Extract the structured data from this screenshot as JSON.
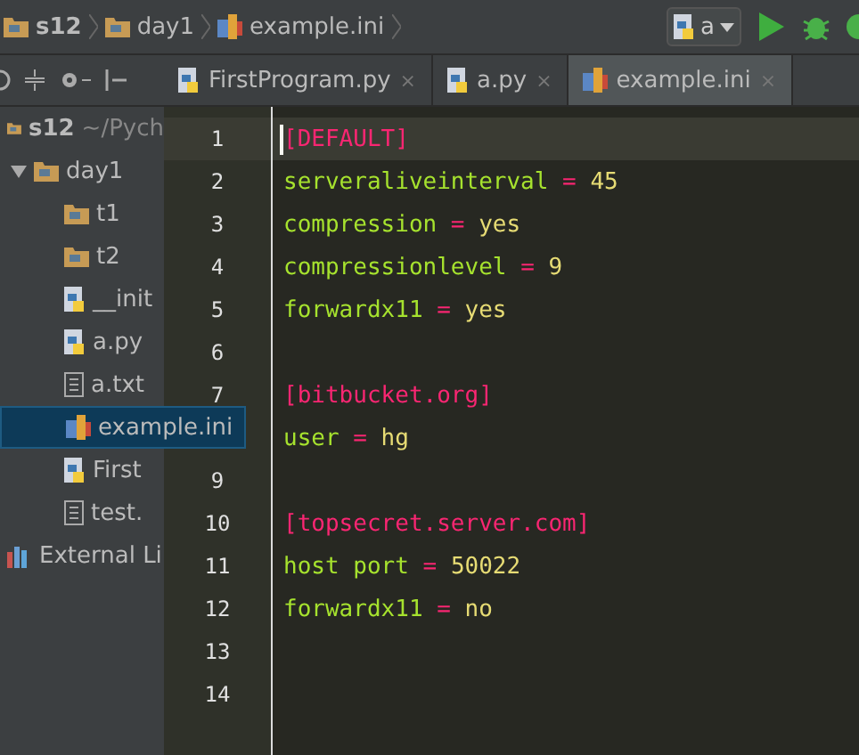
{
  "breadcrumbs": [
    {
      "label": "s12",
      "kind": "folder",
      "bold": true
    },
    {
      "label": "day1",
      "kind": "folder",
      "bold": false
    },
    {
      "label": "example.ini",
      "kind": "ini",
      "bold": false
    }
  ],
  "run_config": {
    "label": "a"
  },
  "tabs": [
    {
      "label": "FirstProgram.py",
      "kind": "python",
      "close": "×",
      "selected": false
    },
    {
      "label": "a.py",
      "kind": "python",
      "close": "×",
      "selected": false
    },
    {
      "label": "example.ini",
      "kind": "ini",
      "close": "×",
      "selected": true
    }
  ],
  "tree": [
    {
      "label": "s12",
      "path": "~/Pych",
      "kind": "folder",
      "selected": false,
      "children": [
        {
          "label": "day1",
          "kind": "folder",
          "expanded": true,
          "selected": false,
          "children": [
            {
              "label": "t1",
              "kind": "folder",
              "selected": false
            },
            {
              "label": "t2",
              "kind": "folder",
              "selected": false
            },
            {
              "label": "__init",
              "kind": "python",
              "selected": false
            },
            {
              "label": "a.py",
              "kind": "python",
              "selected": false
            },
            {
              "label": "a.txt",
              "kind": "text",
              "selected": false
            },
            {
              "label": "example.ini",
              "kind": "ini",
              "selected": true
            },
            {
              "label": "First",
              "kind": "python",
              "selected": false
            },
            {
              "label": "test.",
              "kind": "text",
              "selected": false
            }
          ]
        }
      ]
    },
    {
      "label": "External Li",
      "kind": "library",
      "selected": false
    }
  ],
  "editor": {
    "lines": [
      {
        "number": "1",
        "kind": "section",
        "text": "[DEFAULT]",
        "current": true
      },
      {
        "number": "2",
        "kind": "pair",
        "key": "serveraliveinterval",
        "op": "=",
        "value": "45",
        "current": false
      },
      {
        "number": "3",
        "kind": "pair",
        "key": "compression",
        "op": "=",
        "value": "yes",
        "current": false
      },
      {
        "number": "4",
        "kind": "pair",
        "key": "compressionlevel",
        "op": "=",
        "value": "9",
        "current": false
      },
      {
        "number": "5",
        "kind": "pair",
        "key": "forwardx11",
        "op": "=",
        "value": "yes",
        "current": false
      },
      {
        "number": "6",
        "kind": "blank",
        "current": false
      },
      {
        "number": "7",
        "kind": "section",
        "text": "[bitbucket.org]",
        "current": false
      },
      {
        "kind": "pair",
        "key": "user",
        "op": "=",
        "value": "hg",
        "current": false
      },
      {
        "number": "9",
        "kind": "blank",
        "current": false
      },
      {
        "number": "10",
        "kind": "section",
        "text": "[topsecret.server.com]",
        "current": false
      },
      {
        "number": "11",
        "kind": "pair",
        "key": "host port",
        "op": "=",
        "value": "50022",
        "current": false
      },
      {
        "number": "12",
        "kind": "pair",
        "key": "forwardx11",
        "op": "=",
        "value": "no",
        "current": false
      },
      {
        "number": "13",
        "kind": "blank",
        "current": false
      },
      {
        "number": "14",
        "kind": "blank",
        "current": false
      }
    ]
  }
}
